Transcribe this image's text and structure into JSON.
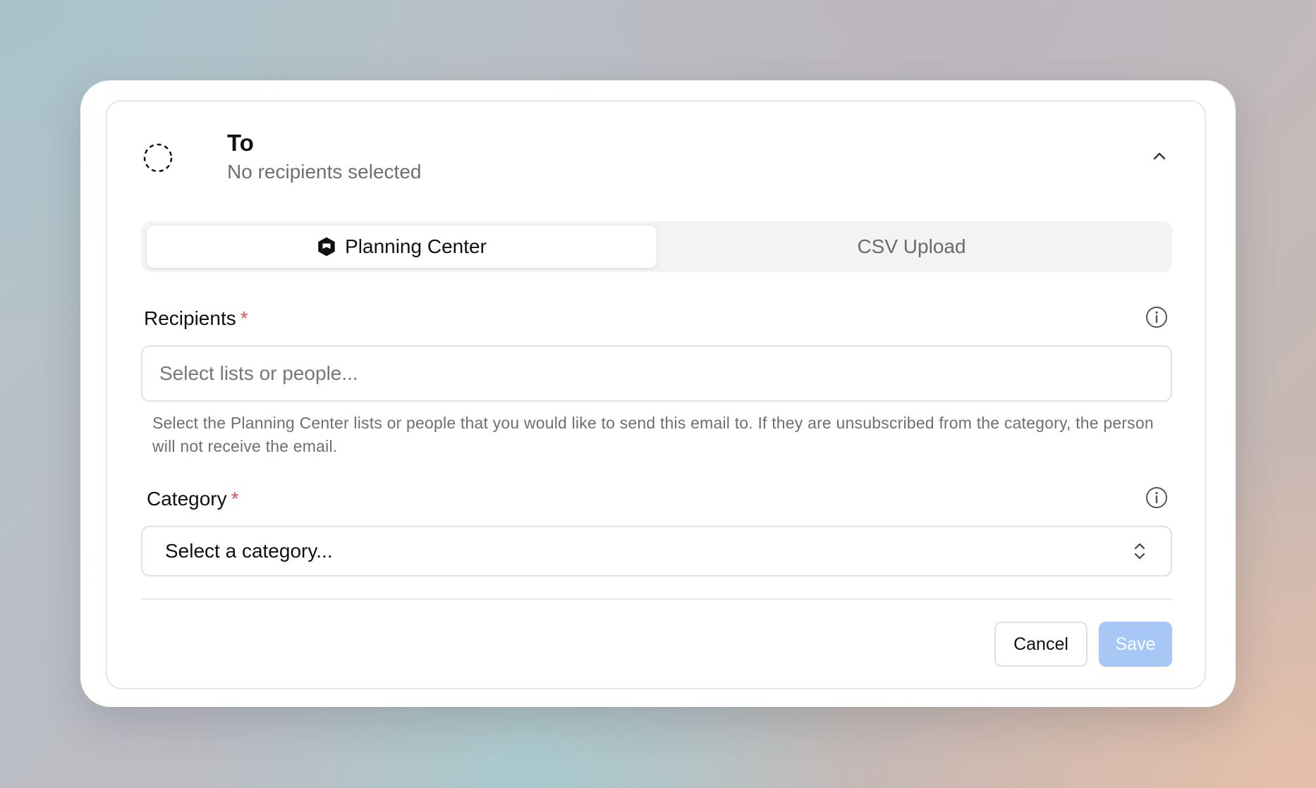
{
  "header": {
    "title": "To",
    "subtitle": "No recipients selected"
  },
  "tabs": [
    {
      "label": "Planning Center",
      "active": true
    },
    {
      "label": "CSV Upload",
      "active": false
    }
  ],
  "recipients": {
    "label": "Recipients",
    "required_mark": "*",
    "placeholder": "Select lists or people...",
    "value": "",
    "help": "Select the Planning Center lists or people that you would like to send this email to. If they are unsubscribed from the category, the person will not receive the email."
  },
  "category": {
    "label": "Category",
    "required_mark": "*",
    "selected": "Select a category..."
  },
  "actions": {
    "cancel_label": "Cancel",
    "save_label": "Save"
  },
  "colors": {
    "accent_disabled": "#a7c8f5",
    "required": "#d9534f",
    "muted_text": "#6f6f6f"
  },
  "icons": {
    "status": "dashed-circle-icon",
    "collapse": "chevron-up-icon",
    "tab_logo": "planning-center-logo-icon",
    "info": "info-icon",
    "select": "chevron-up-down-icon"
  }
}
